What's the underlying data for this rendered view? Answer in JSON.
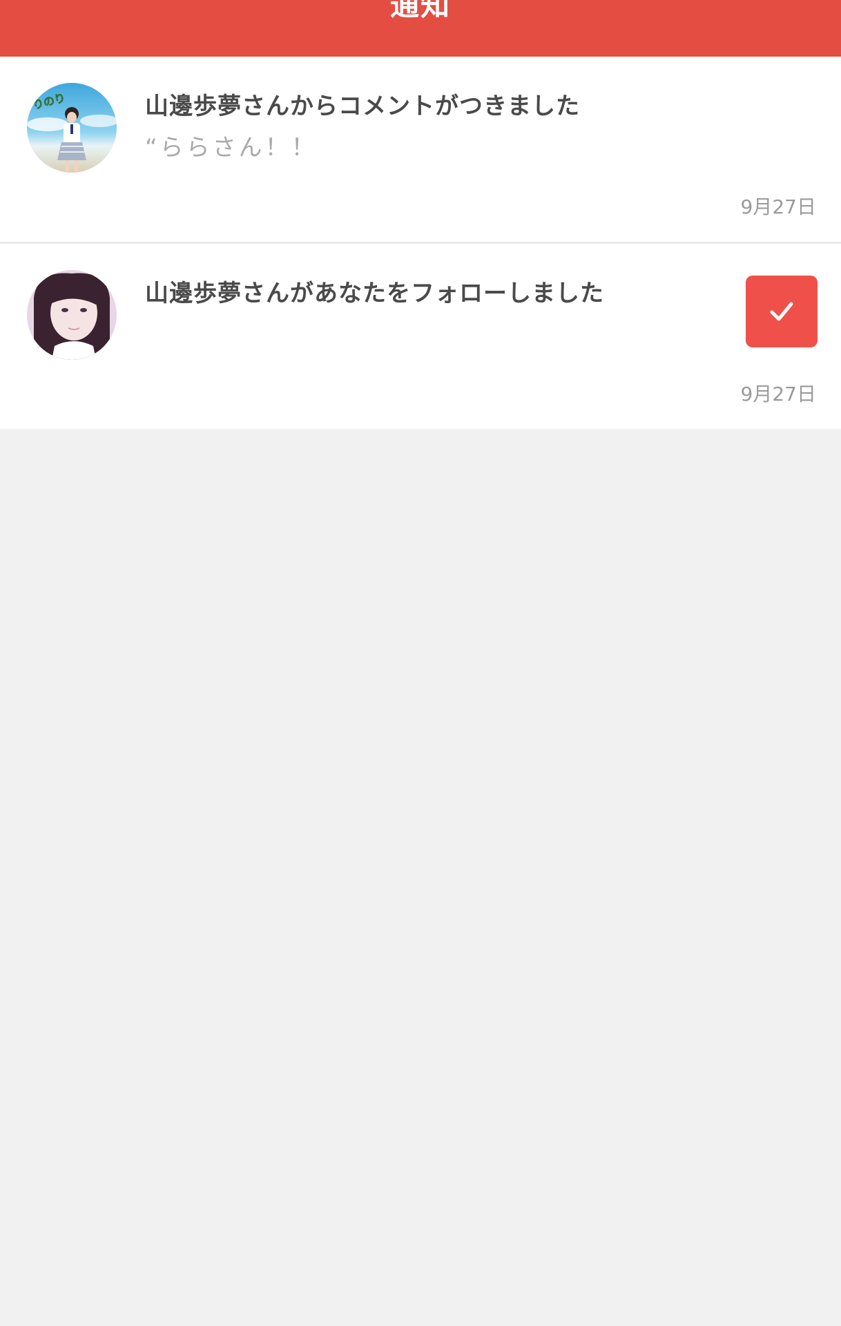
{
  "header": {
    "title": "通知"
  },
  "notifications": [
    {
      "avatar": "user-avatar-beach-photo",
      "title": "山邊歩夢さんからコメントがつきました",
      "comment": "“ららさん！！",
      "date": "9月27日"
    },
    {
      "avatar": "user-avatar-portrait-photo",
      "title": "山邊歩夢さんがあなたをフォローしました",
      "date": "9月27日",
      "action_icon": "checkmark-icon"
    }
  ],
  "colors": {
    "header": "#e34d42",
    "follow_button": "#f0504a",
    "background": "#f1f1f1"
  }
}
